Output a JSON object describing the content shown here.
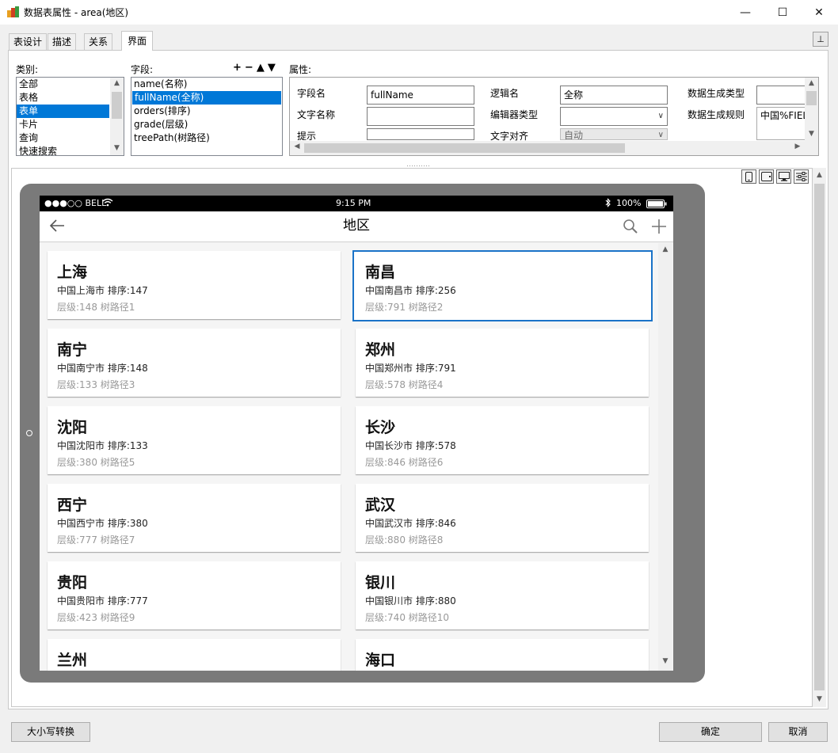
{
  "window": {
    "title": "数据表属性 - area(地区)",
    "minimize_glyph": "—",
    "maximize_glyph": "☐",
    "close_glyph": "✕"
  },
  "tabs": [
    {
      "label": "表设计",
      "active": false
    },
    {
      "label": "描述",
      "active": false
    },
    {
      "label": "关系",
      "active": false
    },
    {
      "label": "界面",
      "active": true
    }
  ],
  "pin_icon": "pin-icon",
  "category": {
    "label": "类别:",
    "items": [
      "全部",
      "表格",
      "表单",
      "卡片",
      "查询",
      "快速搜索"
    ],
    "selected_index": 2
  },
  "fields": {
    "label": "字段:",
    "toolbar": [
      "+",
      "−",
      "▲",
      "▼"
    ],
    "items": [
      "name(名称)",
      "fullName(全称)",
      "orders(排序)",
      "grade(层级)",
      "treePath(树路径)"
    ],
    "selected_index": 1
  },
  "properties": {
    "label": "属性:",
    "field_name_label": "字段名",
    "field_name_value": "fullName",
    "logic_name_label": "逻辑名",
    "logic_name_value": "全称",
    "gen_type_label": "数据生成类型",
    "gen_type_value": "",
    "text_name_label": "文字名称",
    "text_name_value": "",
    "editor_type_label": "编辑器类型",
    "editor_type_value": "",
    "gen_rule_label": "数据生成规则",
    "gen_rule_value": "中国%FIEL",
    "hint_label": "提示",
    "hint_value": "",
    "align_label": "文字对齐",
    "align_value": "自动"
  },
  "view_modes": [
    "phone-icon",
    "tablet-icon",
    "desktop-icon",
    "settings-sliders-icon"
  ],
  "device": {
    "status_left": "●●●○○ BELL",
    "status_time": "9:15 PM",
    "status_battery": "100%",
    "nav_title": "地区",
    "cards": [
      {
        "title": "上海",
        "sub": "中国上海市 排序:147",
        "meta": "层级:148 树路径1"
      },
      {
        "title": "南昌",
        "sub": "中国南昌市 排序:256",
        "meta": "层级:791 树路径2"
      },
      {
        "title": "南宁",
        "sub": "中国南宁市 排序:148",
        "meta": "层级:133 树路径3"
      },
      {
        "title": "郑州",
        "sub": "中国郑州市 排序:791",
        "meta": "层级:578 树路径4"
      },
      {
        "title": "沈阳",
        "sub": "中国沈阳市 排序:133",
        "meta": "层级:380 树路径5"
      },
      {
        "title": "长沙",
        "sub": "中国长沙市 排序:578",
        "meta": "层级:846 树路径6"
      },
      {
        "title": "西宁",
        "sub": "中国西宁市 排序:380",
        "meta": "层级:777 树路径7"
      },
      {
        "title": "武汉",
        "sub": "中国武汉市 排序:846",
        "meta": "层级:880 树路径8"
      },
      {
        "title": "贵阳",
        "sub": "中国贵阳市 排序:777",
        "meta": "层级:423 树路径9"
      },
      {
        "title": "银川",
        "sub": "中国银川市 排序:880",
        "meta": "层级:740 树路径10"
      },
      {
        "title": "兰州",
        "sub": "",
        "meta": ""
      },
      {
        "title": "海口",
        "sub": "",
        "meta": ""
      }
    ],
    "selected_card": 1
  },
  "buttons": {
    "case_convert": "大小写转换",
    "ok": "确定",
    "cancel": "取消"
  },
  "colors": {
    "selection": "#0078d7",
    "card_border": "#1a73c8"
  }
}
